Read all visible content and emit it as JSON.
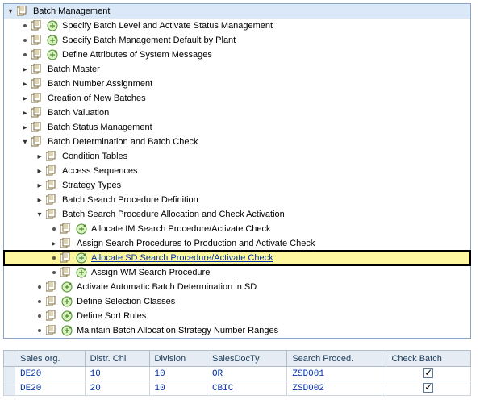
{
  "tree": {
    "root": "Batch Management",
    "n1": "Specify Batch Level and Activate Status Management",
    "n2": "Specify Batch Management Default by Plant",
    "n3": "Define Attributes of System Messages",
    "n4": "Batch Master",
    "n5": "Batch Number Assignment",
    "n6": "Creation of New Batches",
    "n7": "Batch Valuation",
    "n8": "Batch Status Management",
    "n9": "Batch Determination and Batch Check",
    "n9_1": "Condition Tables",
    "n9_2": "Access Sequences",
    "n9_3": "Strategy Types",
    "n9_4": "Batch Search Procedure Definition",
    "n9_5": "Batch Search Procedure Allocation and Check Activation",
    "n9_5_1": "Allocate IM Search Procedure/Activate Check",
    "n9_5_2": "Assign Search Procedures to Production and Activate Check",
    "n9_5_3": "Allocate SD Search Procedure/Activate Check",
    "n9_5_4": "Assign WM Search Procedure",
    "n9_6": "Activate Automatic Batch Determination in SD",
    "n9_7": "Define Selection Classes",
    "n9_8": "Define Sort Rules",
    "n9_9": "Maintain Batch Allocation Strategy Number Ranges"
  },
  "table": {
    "headers": {
      "h1": "Sales org.",
      "h2": "Distr. Chl",
      "h3": "Division",
      "h4": "SalesDocTy",
      "h5": "Search Proced.",
      "h6": "Check Batch"
    },
    "r1": {
      "c1": "DE20",
      "c2": "10",
      "c3": "10",
      "c4": "OR",
      "c5": "ZSD001"
    },
    "r2": {
      "c1": "DE20",
      "c2": "20",
      "c3": "10",
      "c4": "CBIC",
      "c5": "ZSD002"
    }
  }
}
